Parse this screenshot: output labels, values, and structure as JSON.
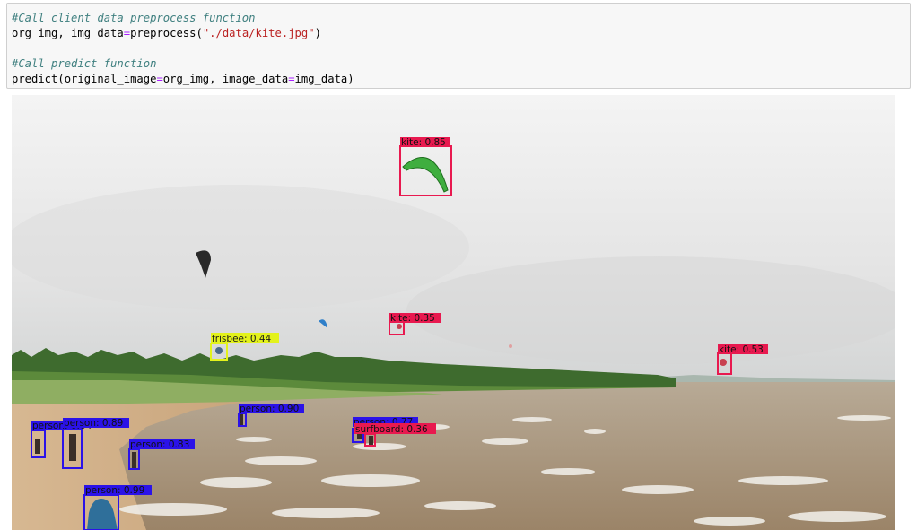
{
  "code_cell": {
    "lines": [
      {
        "type": "comment",
        "text": "#Call client data preprocess function"
      },
      {
        "type": "code",
        "parts": [
          {
            "t": "org_img, img_data",
            "c": ""
          },
          {
            "t": "=",
            "c": "op"
          },
          {
            "t": "preprocess(",
            "c": ""
          },
          {
            "t": "\"./data/kite.jpg\"",
            "c": "st"
          },
          {
            "t": ")",
            "c": ""
          }
        ]
      },
      {
        "type": "blank",
        "text": ""
      },
      {
        "type": "comment",
        "text": "#Call predict function"
      },
      {
        "type": "code",
        "parts": [
          {
            "t": "predict(original_image",
            "c": ""
          },
          {
            "t": "=",
            "c": "op"
          },
          {
            "t": "org_img, image_data",
            "c": ""
          },
          {
            "t": "=",
            "c": "op"
          },
          {
            "t": "img_data)",
            "c": ""
          }
        ]
      }
    ]
  },
  "detections": [
    {
      "label": "kite: 0.85",
      "cls": "kite"
    },
    {
      "label": "kite: 0.35",
      "cls": "kite"
    },
    {
      "label": "kite: 0.53",
      "cls": "kite"
    },
    {
      "label": "frisbee: 0.44",
      "cls": "frisbee"
    },
    {
      "label": "person: 0.90",
      "cls": "person"
    },
    {
      "label": "person: 0.64",
      "cls": "person"
    },
    {
      "label": "person: 0.89",
      "cls": "person"
    },
    {
      "label": "person: 0.83",
      "cls": "person"
    },
    {
      "label": "person: 0.99",
      "cls": "person"
    },
    {
      "label": "person: 0.77",
      "cls": "person"
    },
    {
      "label": "surfboard: 0.36",
      "cls": "surfboard"
    }
  ],
  "colors": {
    "kite": "#e8194f",
    "person": "#2b12e8",
    "frisbee": "#e3f21c",
    "surfboard": "#e8194f"
  }
}
